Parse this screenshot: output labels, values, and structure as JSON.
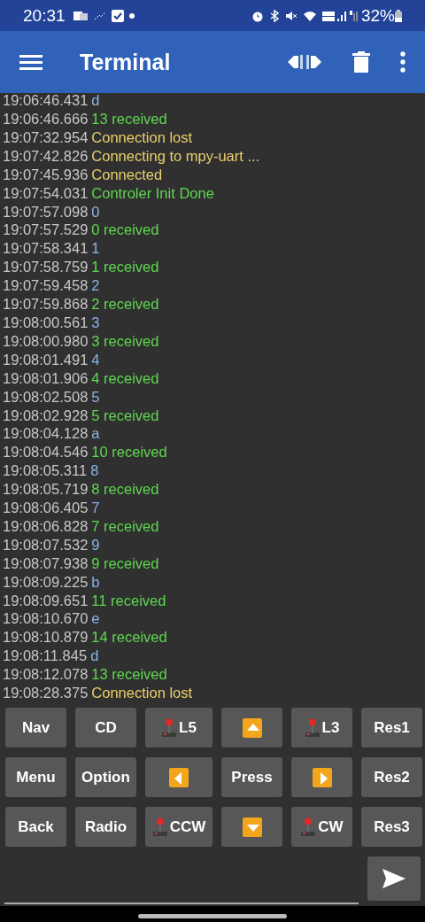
{
  "status_bar": {
    "time": "20:31",
    "battery": "32%"
  },
  "app_bar": {
    "title": "Terminal"
  },
  "log": [
    {
      "time": "19:06:46.431",
      "text": "d",
      "kind": "sent"
    },
    {
      "time": "19:06:46.666",
      "text": "13 received",
      "kind": "received"
    },
    {
      "time": "19:07:32.954",
      "text": "Connection lost",
      "kind": "status"
    },
    {
      "time": "19:07:42.826",
      "text": "Connecting to mpy-uart ...",
      "kind": "status"
    },
    {
      "time": "19:07:45.936",
      "text": "Connected",
      "kind": "status"
    },
    {
      "time": "19:07:54.031",
      "text": "Controler Init Done",
      "kind": "received"
    },
    {
      "time": "19:07:57.098",
      "text": "0",
      "kind": "sent"
    },
    {
      "time": "19:07:57.529",
      "text": "0 received",
      "kind": "received"
    },
    {
      "time": "19:07:58.341",
      "text": "1",
      "kind": "sent"
    },
    {
      "time": "19:07:58.759",
      "text": "1 received",
      "kind": "received"
    },
    {
      "time": "19:07:59.458",
      "text": "2",
      "kind": "sent"
    },
    {
      "time": "19:07:59.868",
      "text": "2 received",
      "kind": "received"
    },
    {
      "time": "19:08:00.561",
      "text": "3",
      "kind": "sent"
    },
    {
      "time": "19:08:00.980",
      "text": "3 received",
      "kind": "received"
    },
    {
      "time": "19:08:01.491",
      "text": "4",
      "kind": "sent"
    },
    {
      "time": "19:08:01.906",
      "text": "4 received",
      "kind": "received"
    },
    {
      "time": "19:08:02.508",
      "text": "5",
      "kind": "sent"
    },
    {
      "time": "19:08:02.928",
      "text": "5 received",
      "kind": "received"
    },
    {
      "time": "19:08:04.128",
      "text": "a",
      "kind": "sent"
    },
    {
      "time": "19:08:04.546",
      "text": "10 received",
      "kind": "received"
    },
    {
      "time": "19:08:05.311",
      "text": "8",
      "kind": "sent"
    },
    {
      "time": "19:08:05.719",
      "text": "8 received",
      "kind": "received"
    },
    {
      "time": "19:08:06.405",
      "text": "7",
      "kind": "sent"
    },
    {
      "time": "19:08:06.828",
      "text": "7 received",
      "kind": "received"
    },
    {
      "time": "19:08:07.532",
      "text": "9",
      "kind": "sent"
    },
    {
      "time": "19:08:07.938",
      "text": "9 received",
      "kind": "received"
    },
    {
      "time": "19:08:09.225",
      "text": "b",
      "kind": "sent"
    },
    {
      "time": "19:08:09.651",
      "text": "11 received",
      "kind": "received"
    },
    {
      "time": "19:08:10.670",
      "text": "e",
      "kind": "sent"
    },
    {
      "time": "19:08:10.879",
      "text": "14 received",
      "kind": "received"
    },
    {
      "time": "19:08:11.845",
      "text": "d",
      "kind": "sent"
    },
    {
      "time": "19:08:12.078",
      "text": "13 received",
      "kind": "received"
    },
    {
      "time": "19:08:28.375",
      "text": "Connection lost",
      "kind": "status"
    }
  ],
  "buttons": [
    {
      "label": "Nav",
      "kind": "text"
    },
    {
      "label": "CD",
      "kind": "text"
    },
    {
      "label": "L5",
      "kind": "joystick"
    },
    {
      "kind": "up"
    },
    {
      "label": "L3",
      "kind": "joystick"
    },
    {
      "label": "Res1",
      "kind": "text"
    },
    {
      "label": "Menu",
      "kind": "text"
    },
    {
      "label": "Option",
      "kind": "text"
    },
    {
      "kind": "left"
    },
    {
      "label": "Press",
      "kind": "text"
    },
    {
      "kind": "right"
    },
    {
      "label": "Res2",
      "kind": "text"
    },
    {
      "label": "Back",
      "kind": "text"
    },
    {
      "label": "Radio",
      "kind": "text"
    },
    {
      "label": "CCW",
      "kind": "joystick"
    },
    {
      "kind": "down"
    },
    {
      "label": "CW",
      "kind": "joystick"
    },
    {
      "label": "Res3",
      "kind": "text"
    }
  ]
}
